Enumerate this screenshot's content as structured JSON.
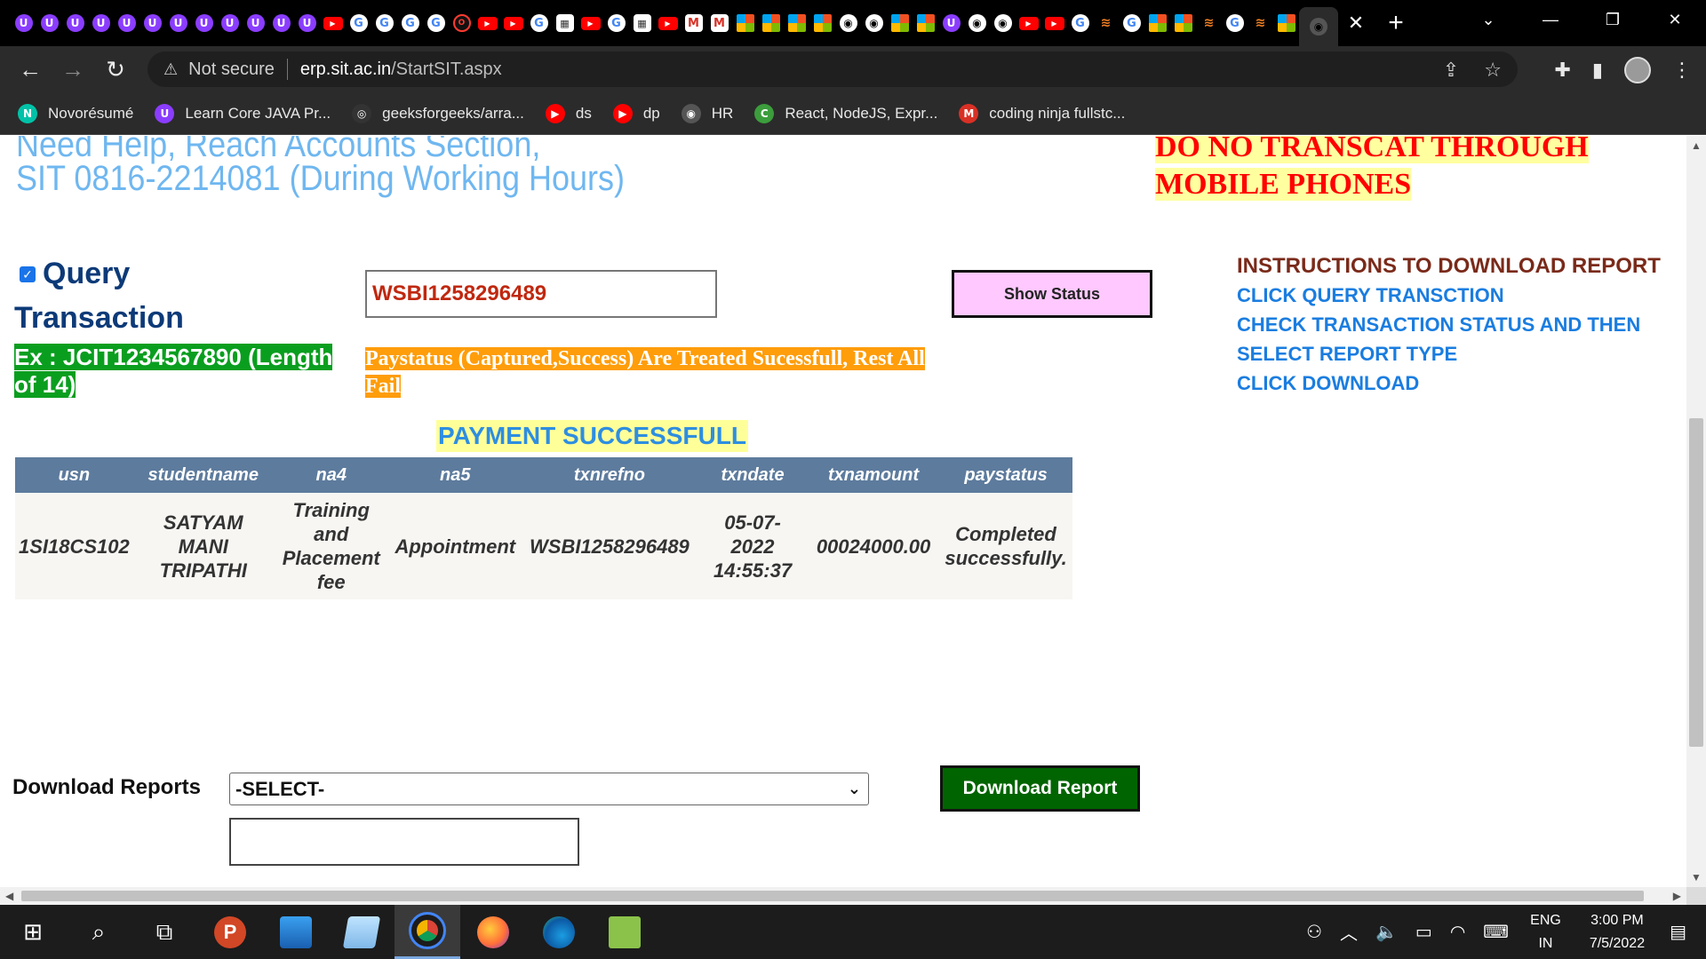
{
  "browser": {
    "tab_favicons": [
      "u",
      "u",
      "u",
      "u",
      "u",
      "u",
      "u",
      "u",
      "u",
      "u",
      "u",
      "u",
      "yt",
      "g",
      "g",
      "g",
      "g",
      "o",
      "yt",
      "yt",
      "g",
      "q",
      "yt",
      "g",
      "q",
      "yt",
      "m",
      "m",
      "ms",
      "ms",
      "ms",
      "ms",
      "ni",
      "ni",
      "ms",
      "ms",
      "u",
      "ni",
      "ni",
      "yt",
      "yt",
      "g",
      "so",
      "g",
      "ms",
      "ms",
      "so",
      "g",
      "so",
      "ms",
      "ni"
    ],
    "tab_close": "✕",
    "new_tab": "+",
    "window_controls": [
      "⌄",
      "—",
      "❐",
      "✕"
    ],
    "address": {
      "security": "Not secure",
      "host": "erp.sit.ac.in",
      "path": "/StartSIT.aspx"
    },
    "bookmarks": [
      {
        "label": "Novorésumé",
        "icon": "N",
        "color": "#00c2a8"
      },
      {
        "label": "Learn Core JAVA Pr...",
        "icon": "U",
        "color": "#8b3dff"
      },
      {
        "label": "geeksforgeeks/arra...",
        "icon": "◎",
        "color": "#333333"
      },
      {
        "label": "ds",
        "icon": "▶",
        "color": "#ff0000"
      },
      {
        "label": "dp",
        "icon": "▶",
        "color": "#ff0000"
      },
      {
        "label": "HR",
        "icon": "◉",
        "color": "#555555"
      },
      {
        "label": "React, NodeJS, Expr...",
        "icon": "C",
        "color": "#3c9d3c"
      },
      {
        "label": "coding ninja fullstc...",
        "icon": "M",
        "color": "#d93025"
      }
    ]
  },
  "page": {
    "help_line1": "Need Help, Reach Accounts Section,",
    "help_line2": "SIT  0816-2214081 (During Working Hours)",
    "warning_line1": "DO NO TRANSCAT THROUGH",
    "warning_line2": "MOBILE PHONES",
    "query_label": "Query Transaction",
    "query_checked": true,
    "txn_value": "WSBI1258296489",
    "show_status_label": "Show Status",
    "example_note": "Ex : JCIT1234567890 (Length of 14)",
    "paystatus_note": "Paystatus (Captured,Success) Are Treated Sucessfull, Rest All Fail",
    "instructions": {
      "title": "INSTRUCTIONS TO DOWNLOAD REPORT",
      "steps": [
        "CLICK QUERY TRANSCTION",
        "CHECK TRANSACTION STATUS AND THEN",
        "SELECT REPORT TYPE",
        "CLICK DOWNLOAD"
      ]
    },
    "payment_status_banner": "PAYMENT SUCCESSFULL",
    "table": {
      "headers": [
        "usn",
        "studentname",
        "na4",
        "na5",
        "txnrefno",
        "txndate",
        "txnamount",
        "paystatus"
      ],
      "rows": [
        [
          "1SI18CS102",
          "SATYAM MANI TRIPATHI",
          "Training and Placement fee",
          "Appointment",
          "WSBI1258296489",
          "05-07-2022 14:55:37",
          "00024000.00",
          "Completed successfully."
        ]
      ]
    },
    "download_label": "Download Reports",
    "download_select_value": "-SELECT-",
    "download_button_label": "Download Report",
    "download_box_value": ""
  },
  "taskbar": {
    "lang_top": "ENG",
    "lang_bottom": "IN",
    "time": "3:00 PM",
    "date": "7/5/2022"
  }
}
